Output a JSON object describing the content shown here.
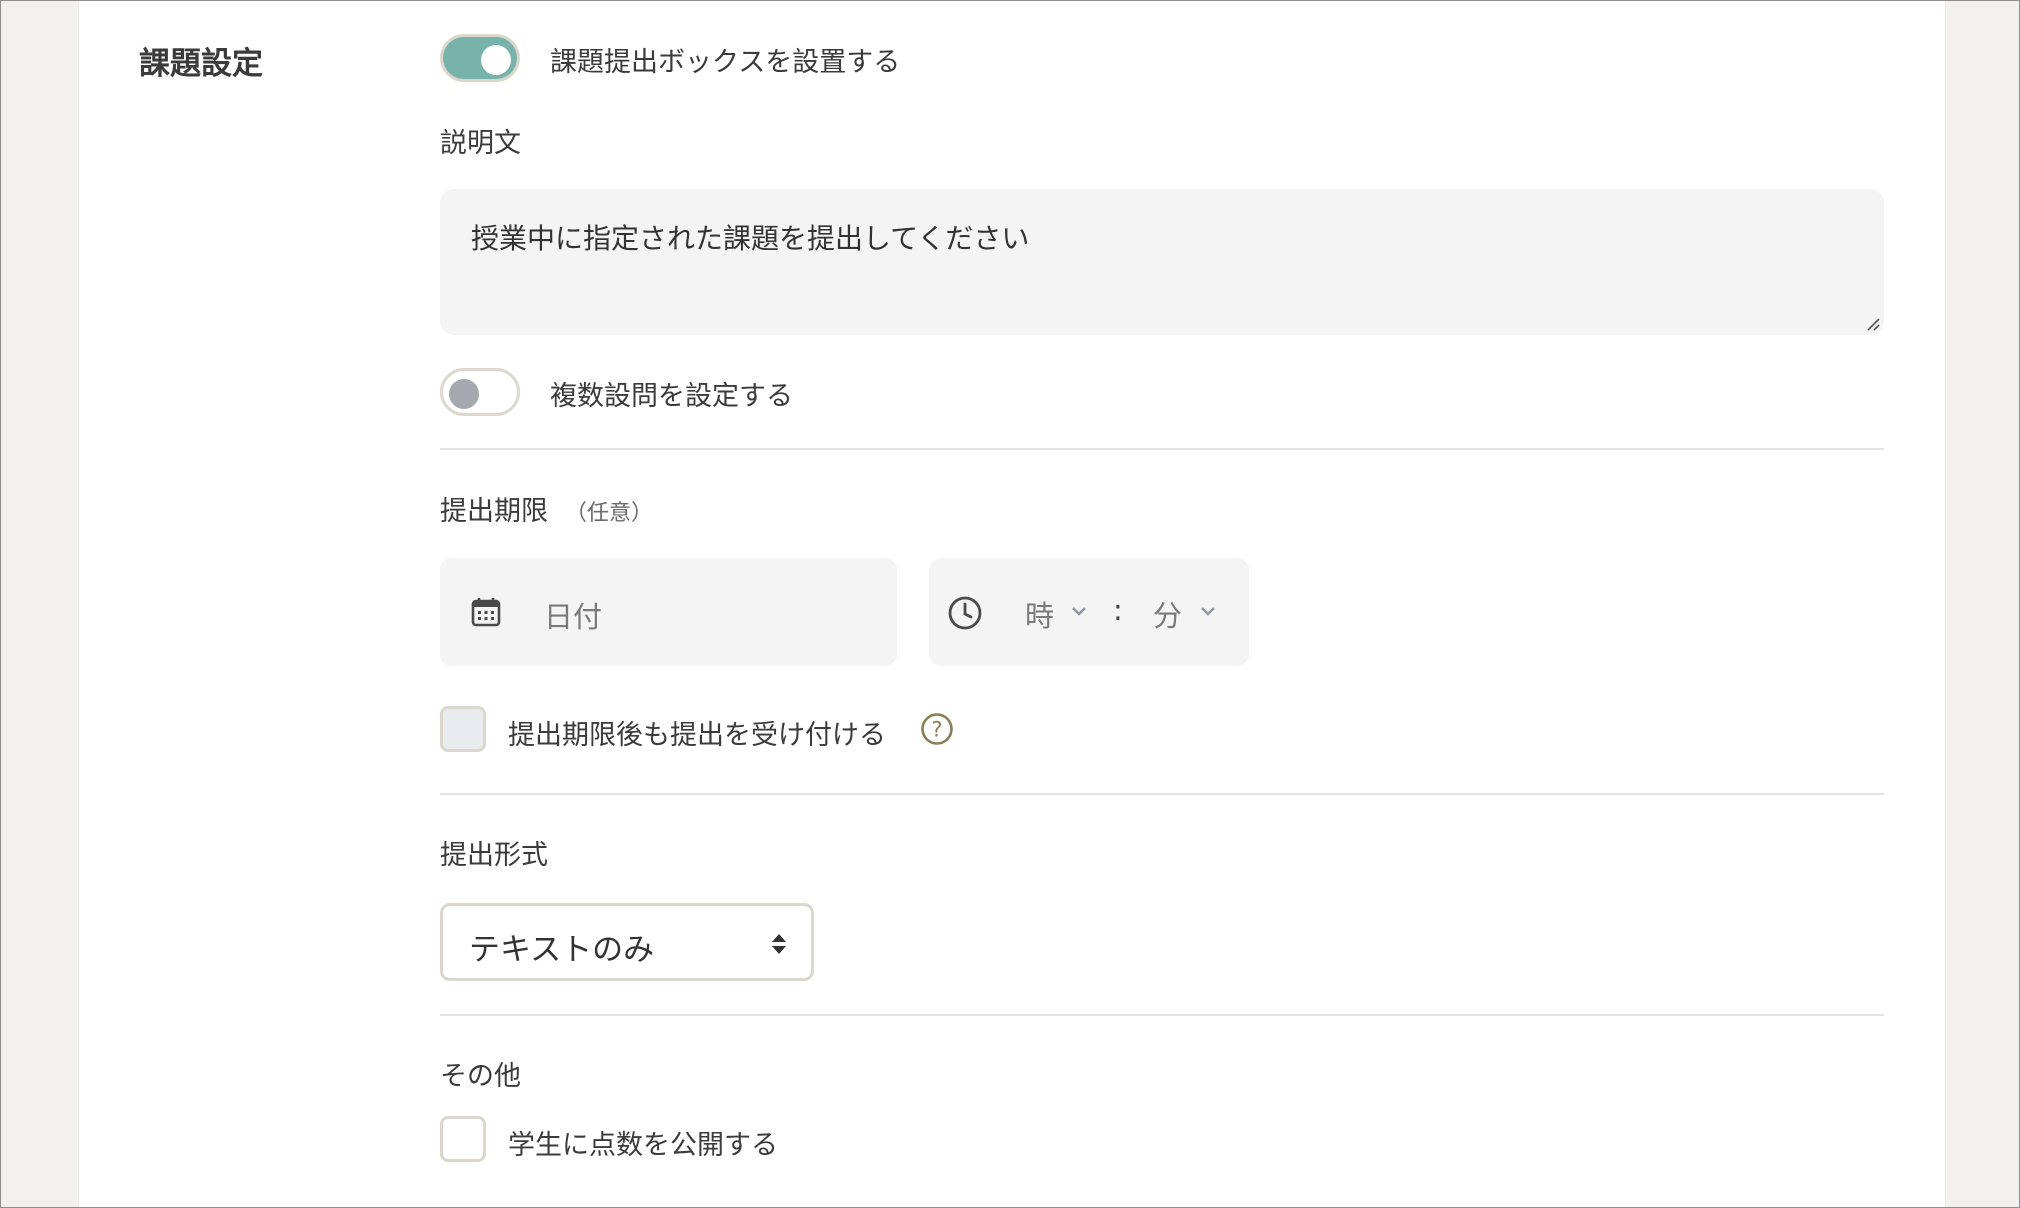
{
  "section": {
    "title": "課題設定"
  },
  "submission_box": {
    "label": "課題提出ボックスを設置する",
    "enabled": true
  },
  "description": {
    "label": "説明文",
    "value": "授業中に指定された課題を提出してください"
  },
  "multiple_questions": {
    "label": "複数設問を設定する",
    "enabled": false
  },
  "deadline": {
    "label": "提出期限",
    "optional_note": "（任意）",
    "date_placeholder": "日付",
    "hour_placeholder": "時",
    "separator": ":",
    "minute_placeholder": "分",
    "late_accept_label": "提出期限後も提出を受け付ける",
    "help_glyph": "?"
  },
  "format": {
    "label": "提出形式",
    "selected": "テキストのみ"
  },
  "other": {
    "label": "その他",
    "publish_scores_label": "学生に点数を公開する"
  },
  "colors": {
    "toggle_on": "#78b3ab",
    "toggle_off_knob": "#a6a9b0",
    "help_icon": "#8a7c57",
    "field_bg": "#f4f4f4"
  },
  "icons": {
    "date": "calendar-icon",
    "time": "clock-icon",
    "help": "help-circle-icon",
    "dropdown": "chevron-down-icon",
    "select": "sort-arrows-icon"
  }
}
